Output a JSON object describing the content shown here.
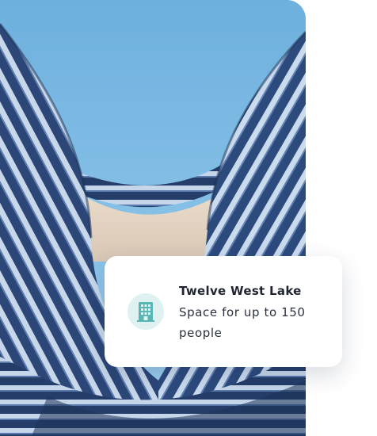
{
  "colors": {
    "sky": "#6fb3e0",
    "facade_dark": "#2c4a7c",
    "facade_light": "#c9d9ec",
    "icon_accent": "#5ab6b4",
    "icon_bg": "#dff1f1"
  },
  "hero": {
    "icon": "building-photo"
  },
  "card": {
    "icon": "office-building-icon",
    "title": "Twelve West Lake",
    "description": "Space for up to 150 people"
  }
}
